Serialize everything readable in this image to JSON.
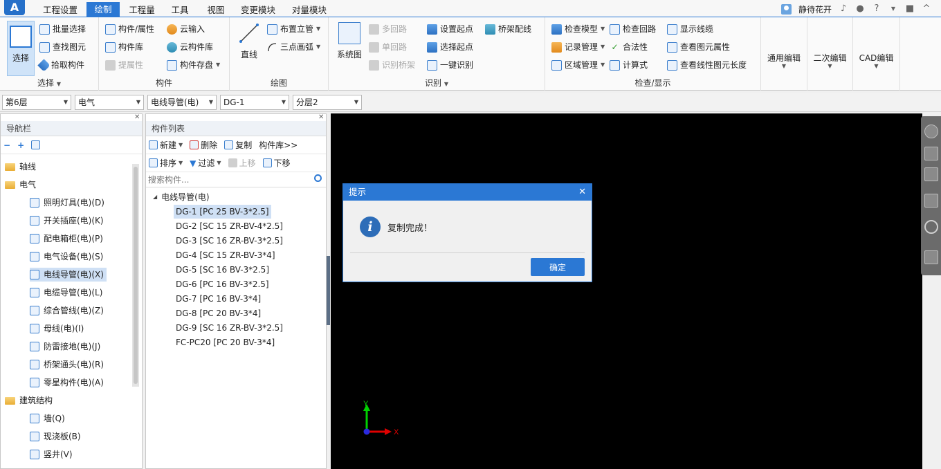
{
  "app": {
    "logo_text": "A",
    "menu_tabs": [
      "工程设置",
      "绘制",
      "工程量",
      "工具",
      "视图",
      "变更模块",
      "对量模块"
    ],
    "active_tab_index": 1,
    "username": "静待花开"
  },
  "ribbon": {
    "select_group": {
      "label": "选择",
      "big_button": "选择",
      "items": [
        "批量选择",
        "查找图元",
        "拾取构件"
      ]
    },
    "component_group": {
      "label": "构件",
      "items": [
        "构件/属性",
        "构件库",
        "提属性",
        "云输入",
        "云构件库",
        "构件存盘"
      ]
    },
    "draw_group": {
      "label": "绘图",
      "big_button": "直线",
      "items": [
        "布置立管",
        "三点画弧"
      ]
    },
    "identify_group": {
      "label": "识别",
      "big_button": "系统图",
      "items": [
        "多回路",
        "单回路",
        "识别桥架",
        "设置起点",
        "选择起点",
        "一键识别",
        "桥架配线"
      ]
    },
    "check_group": {
      "label": "检查/显示",
      "items": [
        "检查模型",
        "记录管理",
        "区域管理",
        "检查回路",
        "合法性",
        "计算式",
        "显示线缆",
        "查看图元属性",
        "查看线性图元长度"
      ]
    },
    "general_edit": "通用编辑",
    "secondary_edit": "二次编辑",
    "cad_edit": "CAD编辑"
  },
  "property_bar": {
    "floor": "第6层",
    "discipline": "电气",
    "type": "电线导管(电)",
    "component": "DG-1",
    "layer": "分层2"
  },
  "nav_panel": {
    "title": "导航栏",
    "items": [
      {
        "label": "轴线",
        "level": 0
      },
      {
        "label": "电气",
        "level": 0
      },
      {
        "label": "照明灯具(电)(D)",
        "level": 1
      },
      {
        "label": "开关插座(电)(K)",
        "level": 1
      },
      {
        "label": "配电箱柜(电)(P)",
        "level": 1
      },
      {
        "label": "电气设备(电)(S)",
        "level": 1
      },
      {
        "label": "电线导管(电)(X)",
        "level": 1,
        "selected": true
      },
      {
        "label": "电缆导管(电)(L)",
        "level": 1
      },
      {
        "label": "综合管线(电)(Z)",
        "level": 1
      },
      {
        "label": "母线(电)(I)",
        "level": 1
      },
      {
        "label": "防雷接地(电)(J)",
        "level": 1
      },
      {
        "label": "桥架通头(电)(R)",
        "level": 1
      },
      {
        "label": "零星构件(电)(A)",
        "level": 1
      },
      {
        "label": "建筑结构",
        "level": 0
      },
      {
        "label": "墙(Q)",
        "level": 1
      },
      {
        "label": "现浇板(B)",
        "level": 1
      },
      {
        "label": "竖井(V)",
        "level": 1
      }
    ]
  },
  "component_panel": {
    "title": "构件列表",
    "toolbar1": [
      "新建",
      "删除",
      "复制",
      "构件库>>"
    ],
    "toolbar2": [
      "排序",
      "过滤",
      "上移",
      "下移"
    ],
    "search_placeholder": "搜索构件...",
    "root": "电线导管(电)",
    "items": [
      "DG-1 [PC 25 BV-3*2.5]",
      "DG-2 [SC 15 ZR-BV-4*2.5]",
      "DG-3 [SC 16 ZR-BV-3*2.5]",
      "DG-4 [SC 15 ZR-BV-3*4]",
      "DG-5 [SC 16 BV-3*2.5]",
      "DG-6 [PC 16 BV-3*2.5]",
      "DG-7 [PC 16 BV-3*4]",
      "DG-8 [PC 20 BV-3*4]",
      "DG-9 [SC 16 ZR-BV-3*2.5]",
      "FC-PC20 [PC 20 BV-3*4]"
    ]
  },
  "canvas": {
    "axis_x": "X",
    "axis_y": "Y"
  },
  "dialog": {
    "title": "提示",
    "message": "复制完成！",
    "ok_label": "确定"
  }
}
